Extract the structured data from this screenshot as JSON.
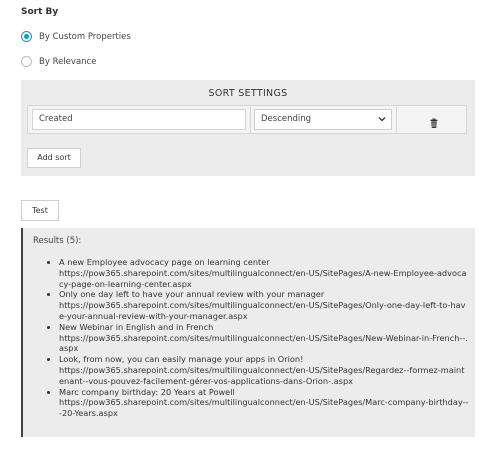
{
  "sort_by": {
    "label": "Sort By",
    "options": [
      {
        "label": "By Custom Properties",
        "checked": true
      },
      {
        "label": "By Relevance",
        "checked": false
      }
    ]
  },
  "sort_settings": {
    "title": "SORT SETTINGS",
    "rows": [
      {
        "field": "Created",
        "order": "Descending"
      }
    ],
    "add_sort_label": "Add sort"
  },
  "test_label": "Test",
  "results": {
    "header": "Results (5):",
    "items": [
      {
        "title": "A new Employee advocacy page on learning center",
        "url": "https://pow365.sharepoint.com/sites/multilingualconnect/en-US/SitePages/A-new-Employee-advocacy-page-on-learning-center.aspx"
      },
      {
        "title": "Only one day left to have your annual review with your manager",
        "url": "https://pow365.sharepoint.com/sites/multilingualconnect/en-US/SitePages/Only-one-day-left-to-have-your-annual-review-with-your-manager.aspx"
      },
      {
        "title": "New Webinar in English and in French",
        "url": "https://pow365.sharepoint.com/sites/multilingualconnect/en-US/SitePages/New-Webinar-in-French--.aspx"
      },
      {
        "title": "Look, from now, you can easily manage your apps in Orion!",
        "url": "https://pow365.sharepoint.com/sites/multilingualconnect/en-US/SitePages/Regardez--formez-maintenant--vous-pouvez-facilement-gérer-vos-applications-dans-Orion-.aspx"
      },
      {
        "title": "Marc company birthday: 20 Years at Powell",
        "url": "https://pow365.sharepoint.com/sites/multilingualconnect/en-US/SitePages/Marc-company-birthday---20-Years.aspx"
      }
    ]
  },
  "colors": {
    "accent": "#0a9bd0",
    "panel_bg": "#ececec"
  },
  "icons": {
    "delete": "trash-icon",
    "dropdown": "chevron-down-icon"
  }
}
